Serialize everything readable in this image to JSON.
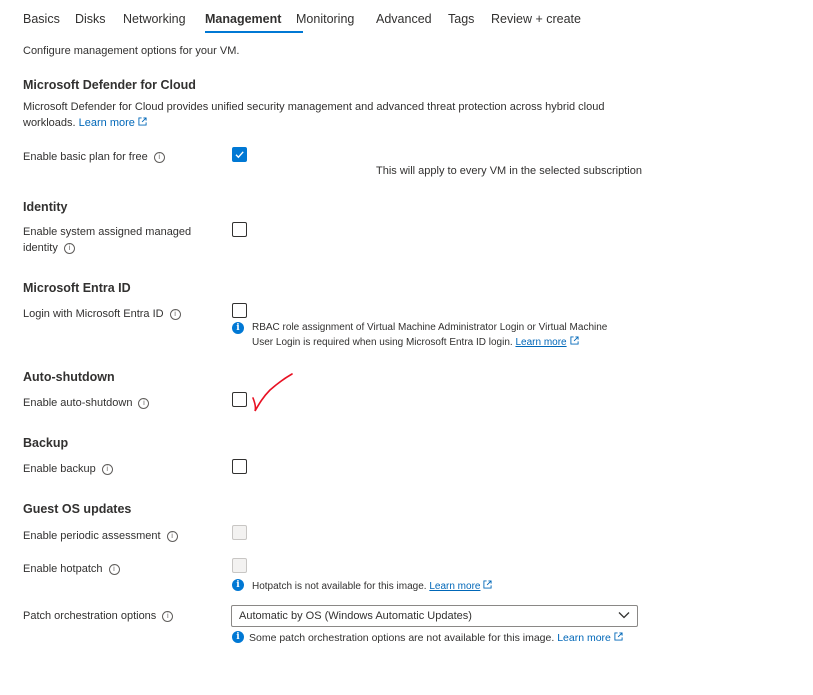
{
  "tabs": [
    {
      "label": "Basics"
    },
    {
      "label": "Disks"
    },
    {
      "label": "Networking"
    },
    {
      "label": "Management",
      "active": true
    },
    {
      "label": "Monitoring"
    },
    {
      "label": "Advanced"
    },
    {
      "label": "Tags"
    },
    {
      "label": "Review + create"
    }
  ],
  "intro": "Configure management options for your VM.",
  "defender": {
    "heading": "Microsoft Defender for Cloud",
    "desc_line1": "Microsoft Defender for Cloud provides unified security management and advanced threat protection across hybrid cloud",
    "desc_line2": "workloads.",
    "learn_more": "Learn more",
    "basic_plan_label": "Enable basic plan for free",
    "basic_plan_checked": true,
    "subscription_note": "This will apply to every VM in the selected subscription"
  },
  "identity": {
    "heading": "Identity",
    "label_line1": "Enable system assigned managed",
    "label_line2": "identity",
    "checked": false
  },
  "entra": {
    "heading": "Microsoft Entra ID",
    "label": "Login with Microsoft Entra ID",
    "checked": false,
    "info_line1": "RBAC role assignment of Virtual Machine Administrator Login or Virtual Machine",
    "info_line2": "User Login is required when using Microsoft Entra ID login.",
    "learn_more": "Learn more"
  },
  "autoshutdown": {
    "heading": "Auto-shutdown",
    "label": "Enable auto-shutdown",
    "checked": false,
    "annotation_color": "#e81123"
  },
  "backup": {
    "heading": "Backup",
    "label": "Enable backup",
    "checked": false
  },
  "guest_os": {
    "heading": "Guest OS updates",
    "periodic_label": "Enable periodic assessment",
    "hotpatch_label": "Enable hotpatch",
    "hotpatch_info": "Hotpatch is not available for this image.",
    "hotpatch_learn_more": "Learn more",
    "patch_label": "Patch orchestration options",
    "patch_value": "Automatic by OS (Windows Automatic Updates)",
    "patch_info": "Some patch orchestration options are not available for this image.",
    "patch_learn_more": "Learn more"
  },
  "colors": {
    "accent": "#0078d4",
    "link": "#0067b8",
    "text": "#323130"
  }
}
